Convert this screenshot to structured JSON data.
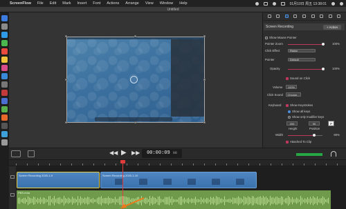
{
  "menubar": {
    "app_name": "ScreenFlow",
    "items": [
      "File",
      "Edit",
      "Mark",
      "Insert",
      "Font",
      "Actions",
      "Arrange",
      "View",
      "Window",
      "Help"
    ],
    "clock": "01月10日 周五 13:38:01"
  },
  "window": {
    "title": "Untitled"
  },
  "inspector": {
    "section_title": "Screen Recording",
    "action_label": "+ Action",
    "show_mouse_pointer": "Show Mouse Pointer",
    "pointer_zoom_label": "Pointer Zoom",
    "pointer_zoom_value": "100%",
    "click_effect_label": "Click Effect",
    "click_effect_value": "Radar",
    "pointer_label": "Pointer",
    "pointer_value": "Default",
    "opacity_label": "Opacity",
    "opacity_value": "100%",
    "sound_on_click": "Sound on Click",
    "volume_label": "Volume",
    "volume_value": "100%",
    "click_sound_label": "Click Sound",
    "click_sound_value": "Choose...",
    "keyboard_label": "Keyboard",
    "show_keystrokes": "Show Keystrokes",
    "show_all_keys": "Show all keys",
    "show_modifier_keys": "Show only modifier keys",
    "height_value": "200",
    "position_value": "90",
    "height_label": "Height",
    "position_label": "Position",
    "font_btn": "F",
    "width_label": "Width",
    "width_value": "80%",
    "attached_to_clip": "Attached To Clip"
  },
  "transport": {
    "timecode": "00:00:09",
    "timecode_frames": "08"
  },
  "timeline": {
    "clip1_label": "Screen Recording 2020-1-9",
    "clip2_label": "Screen Recording 2020-1-10",
    "audio_label": "PBS.m4a"
  },
  "colors": {
    "accent": "#c0395d",
    "clip_blue": "#3a72ad",
    "audio_green": "#6f9a4c",
    "playhead": "#e23b3b",
    "selection": "#e5d24a"
  }
}
